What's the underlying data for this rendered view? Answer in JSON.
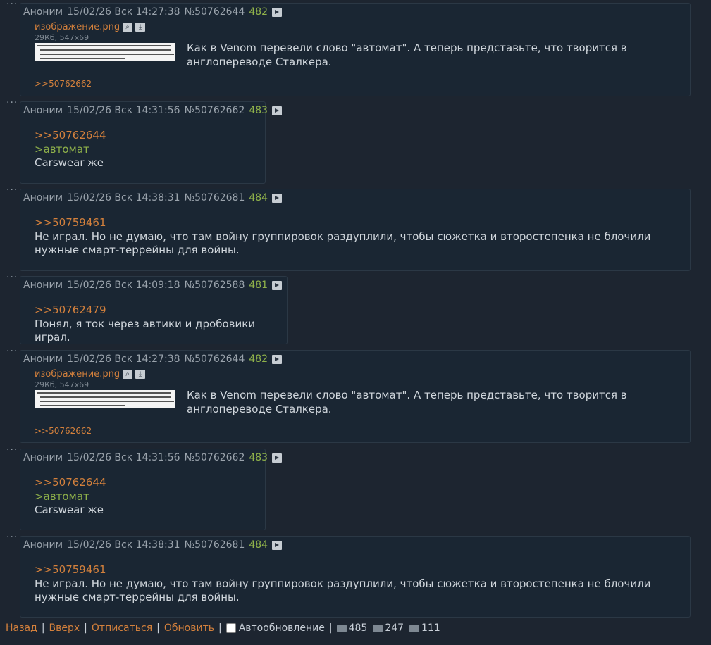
{
  "posts": [
    {
      "name": "Аноним",
      "date": "15/02/26 Вск 14:27:38",
      "num": "№50762644",
      "count": "482",
      "file": {
        "name": "изображение.png",
        "info": "29Кб, 547x69"
      },
      "text": "Как в Venom перевели слово \"автомат\". А теперь представьте, что творится в англопереводе Сталкера.",
      "reply_link": ">>50762662"
    },
    {
      "name": "Аноним",
      "date": "15/02/26 Вск 14:31:56",
      "num": "№50762662",
      "count": "483",
      "reply": ">>50762644",
      "quote": ">автомат",
      "text": "Carswear же"
    },
    {
      "name": "Аноним",
      "date": "15/02/26 Вск 14:38:31",
      "num": "№50762681",
      "count": "484",
      "reply": ">>50759461",
      "text": "Не играл. Но не думаю, что там войну группировок раздуплили, чтобы сюжетка и второстепенка не блочили нужные смарт-террейны для войны."
    },
    {
      "name": "Аноним",
      "date": "15/02/26 Вск 14:09:18",
      "num": "№50762588",
      "count": "481",
      "reply": ">>50762479",
      "text": "Понял, я ток через автики и дробовики играл."
    },
    {
      "name": "Аноним",
      "date": "15/02/26 Вск 14:27:38",
      "num": "№50762644",
      "count": "482",
      "file": {
        "name": "изображение.png",
        "info": "29Кб, 547x69"
      },
      "text": "Как в Venom перевели слово \"автомат\". А теперь представьте, что творится в англопереводе Сталкера.",
      "reply_link": ">>50762662"
    },
    {
      "name": "Аноним",
      "date": "15/02/26 Вск 14:31:56",
      "num": "№50762662",
      "count": "483",
      "reply": ">>50762644",
      "quote": ">автомат",
      "text": "Carswear же"
    },
    {
      "name": "Аноним",
      "date": "15/02/26 Вск 14:38:31",
      "num": "№50762681",
      "count": "484",
      "reply": ">>50759461",
      "text": "Не играл. Но не думаю, что там войну группировок раздуплили, чтобы сюжетка и второстепенка не блочили нужные смарт-террейны для войны."
    }
  ],
  "footer": {
    "back": "Назад",
    "up": "Вверх",
    "unsubscribe": "Отписаться",
    "refresh": "Обновить",
    "autoupdate": "Автообновление",
    "posts_count": "485",
    "images_count": "247",
    "users_count": "111"
  }
}
